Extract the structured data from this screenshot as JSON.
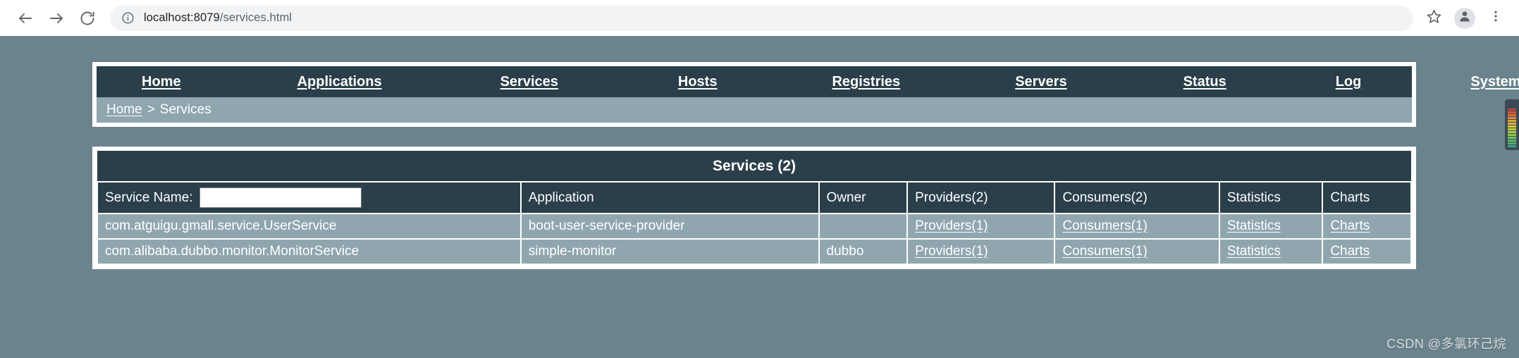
{
  "browser": {
    "back_icon": "back-arrow-icon",
    "forward_icon": "forward-arrow-icon",
    "reload_icon": "reload-icon",
    "info_icon": "site-info-icon",
    "url_host": "localhost:8079",
    "url_path": "/services.html",
    "url_full": "localhost:8079/services.html",
    "star_icon": "bookmark-star-icon",
    "avatar_icon": "profile-avatar-icon",
    "menu_icon": "three-dot-menu-icon"
  },
  "nav": {
    "items": [
      {
        "label": "Home",
        "key": "home"
      },
      {
        "label": "Applications",
        "key": "applications"
      },
      {
        "label": "Services",
        "key": "services"
      },
      {
        "label": "Hosts",
        "key": "hosts"
      },
      {
        "label": "Registries",
        "key": "registries"
      },
      {
        "label": "Servers",
        "key": "servers"
      },
      {
        "label": "Status",
        "key": "status"
      },
      {
        "label": "Log",
        "key": "log"
      },
      {
        "label": "System",
        "key": "system"
      }
    ]
  },
  "breadcrumb": {
    "home": "Home",
    "separator": ">",
    "current": "Services"
  },
  "panel": {
    "title": "Services (2)"
  },
  "search": {
    "label": "Service Name:",
    "value": "",
    "placeholder": ""
  },
  "table": {
    "columns": [
      "Application",
      "Owner",
      "Providers(2)",
      "Consumers(2)",
      "Statistics",
      "Charts"
    ],
    "rows": [
      {
        "service": "com.atguigu.gmall.service.UserService",
        "application": "boot-user-service-provider",
        "owner": "",
        "providers": "Providers(1)",
        "consumers": "Consumers(1)",
        "statistics": "Statistics",
        "charts": "Charts"
      },
      {
        "service": "com.alibaba.dubbo.monitor.MonitorService",
        "application": "simple-monitor",
        "owner": "dubbo",
        "providers": "Providers(1)",
        "consumers": "Consumers(1)",
        "statistics": "Statistics",
        "charts": "Charts"
      }
    ]
  },
  "gadget": {
    "name": "system-monitor-gadget",
    "bars": [
      "#3fa08a",
      "#4fae7a",
      "#63b869",
      "#78c158",
      "#8fc84c",
      "#a8ce44",
      "#c0cf3e",
      "#d2c73b",
      "#dcb83a",
      "#e2a339",
      "#e48b39",
      "#e2703a",
      "#d9563c",
      "#c8413e"
    ]
  },
  "watermark": "CSDN @多氯环己烷"
}
